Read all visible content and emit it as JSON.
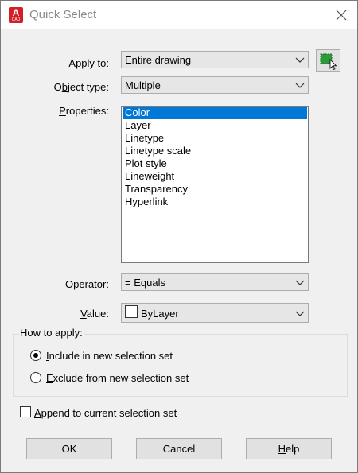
{
  "window": {
    "title": "Quick Select",
    "app_icon_letter": "A",
    "app_icon_sub": "CAD"
  },
  "apply_to": {
    "label": "Apply to:",
    "value": "Entire drawing"
  },
  "object_type": {
    "label_pre": "O",
    "label_u": "b",
    "label_post": "ject type:",
    "value": "Multiple"
  },
  "properties": {
    "label_u": "P",
    "label_post": "roperties:",
    "items": [
      "Color",
      "Layer",
      "Linetype",
      "Linetype scale",
      "Plot style",
      "Lineweight",
      "Transparency",
      "Hyperlink"
    ],
    "selected": "Color"
  },
  "operator": {
    "label_pre": "Operato",
    "label_u": "r",
    "label_post": ":",
    "value": "= Equals"
  },
  "value": {
    "label_u": "V",
    "label_post": "alue:",
    "value": "ByLayer",
    "swatch_color": "#ffffff"
  },
  "how_to_apply": {
    "label": "How to apply:",
    "include": {
      "u": "I",
      "rest": "nclude in new selection set",
      "checked": true
    },
    "exclude": {
      "u": "E",
      "rest": "xclude from new selection set",
      "checked": false
    }
  },
  "append": {
    "u": "A",
    "rest": "ppend to current selection set",
    "checked": false
  },
  "buttons": {
    "ok": "OK",
    "cancel": "Cancel",
    "help_u": "H",
    "help_rest": "elp"
  },
  "colors": {
    "selection": "#0078d7",
    "app_icon": "#d21f2a",
    "pick_green": "#2e9a3a"
  }
}
